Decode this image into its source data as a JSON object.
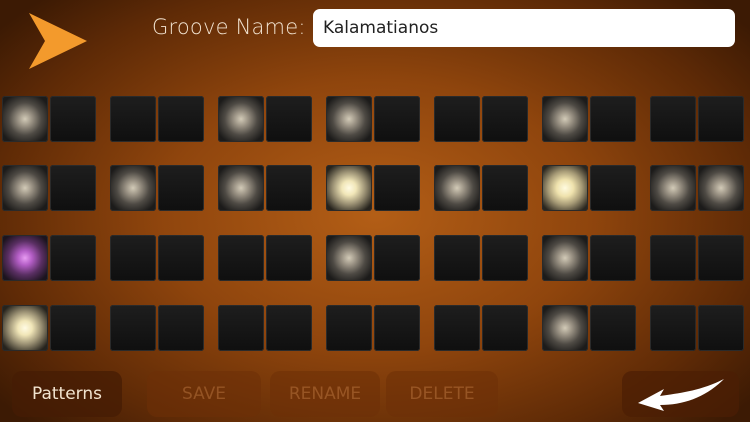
{
  "header": {
    "play_icon": "play-triangle-icon",
    "groove_label": "Groove Name:",
    "groove_name": "Kalamatianos"
  },
  "colors": {
    "accent": "#f39a2c",
    "pad_off": "#151515",
    "pad_on": "#f4ecc8",
    "pad_accent": "#c070d2"
  },
  "grid": {
    "rows": [
      [
        "l1",
        "off",
        "off",
        "off",
        "l1",
        "off",
        "l1",
        "off",
        "off",
        "off",
        "l1",
        "off",
        "off",
        "off"
      ],
      [
        "l1",
        "off",
        "l1",
        "off",
        "l1",
        "off",
        "l2",
        "off",
        "l1",
        "off",
        "l3",
        "off",
        "l1",
        "l1"
      ],
      [
        "purple",
        "off",
        "off",
        "off",
        "off",
        "off",
        "l1",
        "off",
        "off",
        "off",
        "l1",
        "off",
        "off",
        "off"
      ],
      [
        "l2",
        "off",
        "off",
        "off",
        "off",
        "off",
        "off",
        "off",
        "off",
        "off",
        "l1",
        "off",
        "off",
        "off"
      ]
    ]
  },
  "footer": {
    "patterns_label": "Patterns",
    "save_label": "SAVE",
    "rename_label": "RENAME",
    "delete_label": "DELETE",
    "next_icon": "curved-arrow-left-icon"
  }
}
